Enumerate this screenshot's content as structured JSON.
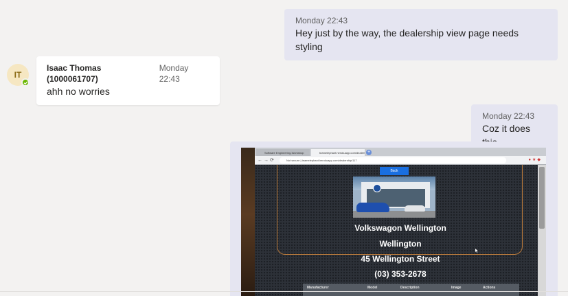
{
  "messages": [
    {
      "time": "Monday 22:43",
      "text": "Hey just by the way, the dealership view page needs styling"
    },
    {
      "sender": "Isaac Thomas (1000061707)",
      "initials": "IT",
      "time": "Monday 22:43",
      "text": "ahh no worries"
    },
    {
      "time": "Monday 22:43",
      "text": "Coz it does this"
    }
  ],
  "screenshot": {
    "tabs": [
      "Software Engineering-Workshop",
      "teamelephant.herokuapp.com/dealership/117"
    ],
    "url": "Not secure | teamelephant.herokuapp.com/dealership/117",
    "back_label": "Back",
    "dealer_name": "Volkswagon Wellington",
    "city": "Wellington",
    "street": "45 Wellington Street",
    "phone": "(03) 353-2678",
    "table_headers": [
      "Manufacturer",
      "Model",
      "Description",
      "Image",
      "Actions"
    ]
  },
  "colors": {
    "my_bubble": "#e5e5f1",
    "other_bubble": "#ffffff",
    "presence": "#6bb700",
    "background": "#f3f2f1"
  }
}
